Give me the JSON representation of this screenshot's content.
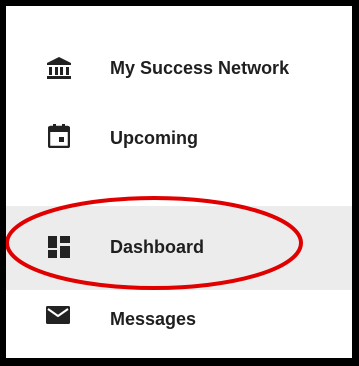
{
  "sidebar": {
    "items": [
      {
        "label": "My Success Network",
        "icon": "bank-icon"
      },
      {
        "label": "Upcoming",
        "icon": "calendar-icon"
      },
      {
        "label": "Dashboard",
        "icon": "dashboard-icon",
        "active": true
      },
      {
        "label": "Messages",
        "icon": "mail-icon"
      }
    ]
  },
  "annotation": {
    "shape": "ellipse",
    "color": "#e00000",
    "highlights": "Dashboard"
  },
  "colors": {
    "active_background": "#ececec",
    "text": "#1f1f1f",
    "icon": "#222222"
  }
}
